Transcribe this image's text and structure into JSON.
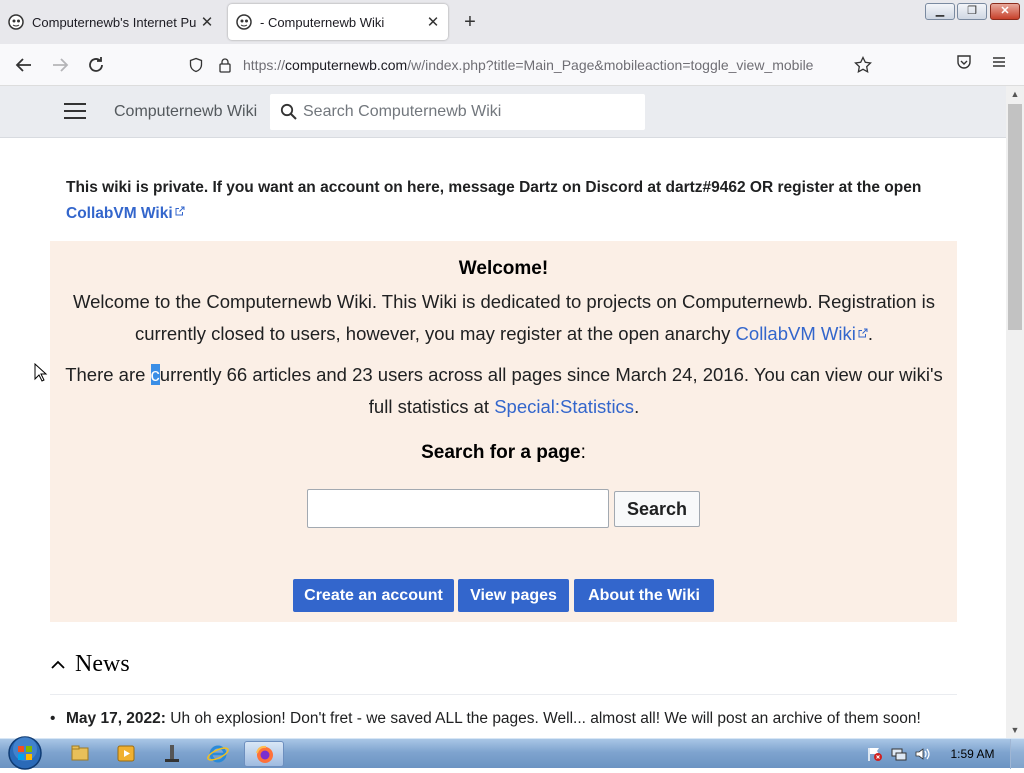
{
  "browser": {
    "tabs": [
      {
        "title": "Computernewb's Internet Pub H",
        "active": false
      },
      {
        "title": "- Computernewb Wiki",
        "active": true
      }
    ],
    "url": {
      "prefix": "https://",
      "host": "computernewb.com",
      "path": "/w/index.php?title=Main_Page&mobileaction=toggle_view_mobile"
    }
  },
  "wiki": {
    "site_title": "Computernewb Wiki",
    "search_placeholder": "Search Computernewb Wiki",
    "notice_text": "This wiki is private. If you want an account on here, message Dartz on Discord at dartz#9462 OR register at the open",
    "notice_link": "CollabVM Wiki",
    "welcome": {
      "heading": "Welcome!",
      "intro": "Welcome to the Computernewb Wiki. This Wiki is dedicated to projects on Computernewb. Registration is currently closed to users, however, you may register at the open anarchy",
      "intro_link": "CollabVM Wiki",
      "intro_end": ".",
      "stats_before": "There are ",
      "stats_selected": "c",
      "stats_after": "urrently 66 articles and 23 users across all pages since March 24, 2016. You can view our wiki's full statistics at",
      "stats_link": "Special:Statistics",
      "stats_end": ".",
      "search_heading_bold": "Search for a page",
      "search_heading_colon": ":",
      "search_button": "Search",
      "buttons": {
        "create": "Create an account",
        "view": "View pages",
        "about": "About the Wiki"
      }
    },
    "news": {
      "title": "News",
      "items": [
        {
          "date": "May 17, 2022:",
          "text": " Uh oh explosion! Don't fret - we saved ALL the pages. Well... almost all! We will post an archive of them soon!"
        }
      ]
    }
  },
  "taskbar": {
    "clock": "1:59 AM"
  },
  "colors": {
    "link": "#3366cc",
    "welcome_bg": "#fbefe6",
    "header_bg": "#eaecf0"
  }
}
